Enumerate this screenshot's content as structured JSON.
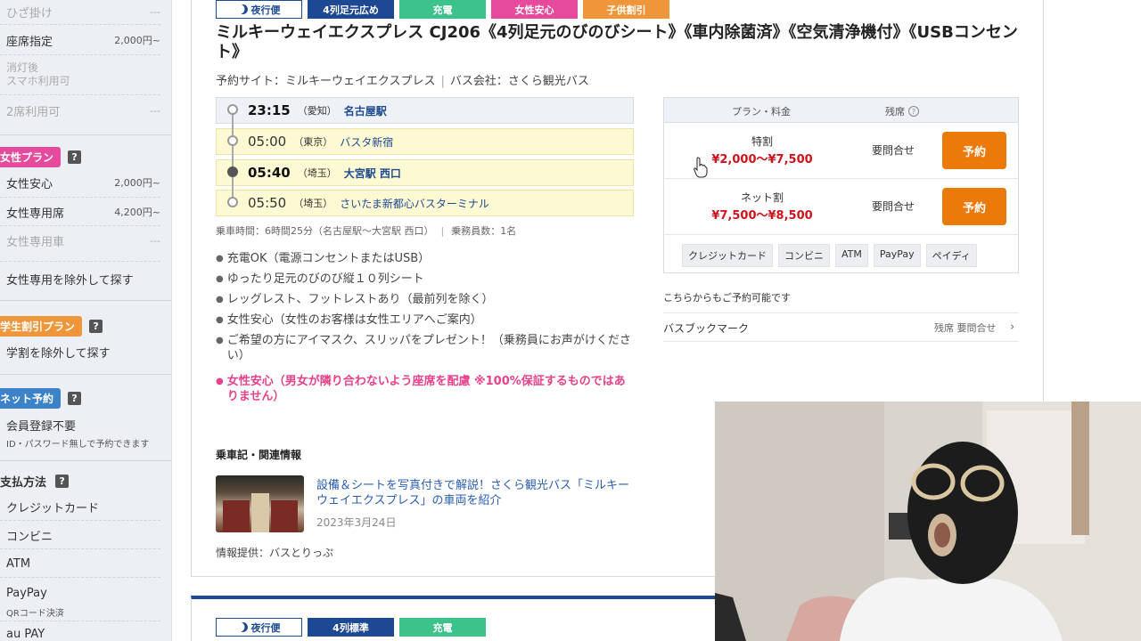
{
  "sidebar": {
    "items_top": [
      {
        "label": "ひざ掛け",
        "price": "---"
      },
      {
        "label": "座席指定",
        "price": "2,000円~"
      }
    ],
    "lights_off_line1": "消灯後",
    "lights_off_line2": "スマホ利用可",
    "two_seats": {
      "label": "2席利用可",
      "price": "---"
    },
    "women_plan": {
      "tag": "女性プラン",
      "help": "?"
    },
    "women_items": [
      {
        "label": "女性安心",
        "price": "2,000円~"
      },
      {
        "label": "女性専用席",
        "price": "4,200円~"
      },
      {
        "label": "女性専用車",
        "price": "---"
      }
    ],
    "exclude_women": "女性専用を除外して探す",
    "student_plan": {
      "tag": "学生割引プラン",
      "help": "?"
    },
    "exclude_student": "学割を除外して探す",
    "net_booking": {
      "tag": "ネット予約",
      "help": "?"
    },
    "no_membership": "会員登録不要",
    "no_membership_sub": "ID・パスワード無しで予約できます",
    "payment_head": "支払方法",
    "payment_help": "?",
    "payments": [
      "クレジットカード",
      "コンビニ",
      "ATM",
      "PayPay"
    ],
    "paypay_sub": "QRコード決済",
    "aupay": "au PAY"
  },
  "listing": {
    "badges": [
      "夜行便",
      "4列足元広め",
      "充電",
      "女性安心",
      "子供割引"
    ],
    "title": "ミルキーウェイエクスプレス CJ206《4列足元のびのびシート》《車内除菌済》《空気清浄機付》《USBコンセント》",
    "booking_site": "予約サイト：ミルキーウェイエクスプレス",
    "bus_company": "バス会社：さくら観光バス",
    "stops": [
      {
        "time": "23:15",
        "pref": "（愛知）",
        "place": "名古屋駅"
      },
      {
        "time": "05:00",
        "pref": "（東京）",
        "place": "バスタ新宿"
      },
      {
        "time": "05:40",
        "pref": "（埼玉）",
        "place": "大宮駅 西口"
      },
      {
        "time": "05:50",
        "pref": "（埼玉）",
        "place": "さいたま新都心バスターミナル"
      }
    ],
    "ride_time": "乗車時間：6時間25分（名古屋駅～大宮駅 西口）",
    "crew": "乗務員数：1名",
    "features": [
      "充電OK（電源コンセントまたはUSB）",
      "ゆったり足元のびのび縦１０列シート",
      "レッグレスト、フットレストあり（最前列を除く）",
      "女性安心（女性のお客様は女性エリアへご案内）",
      "ご希望の方にアイマスク、スリッパをプレゼント！（乗務員にお声がけください）"
    ],
    "women_note": "女性安心（男女が隣り合わないよう座席を配慮 ※100%保証するものではありません）",
    "related_head": "乗車記・関連情報",
    "related_link": "設備＆シートを写真付きで解説！さくら観光バス「ミルキーウェイエクスプレス」の車両を紹介",
    "related_date": "2023年3月24日",
    "provider": "情報提供：バスとりっぷ"
  },
  "price_table": {
    "col_plan": "プラン・料金",
    "col_seats": "残席",
    "rows": [
      {
        "name": "特割",
        "price": "¥2,000～¥7,500",
        "seats": "要問合せ",
        "button": "予約"
      },
      {
        "name": "ネット割",
        "price": "¥7,500～¥8,500",
        "seats": "要問合せ",
        "button": "予約"
      }
    ],
    "payments": [
      "クレジットカード",
      "コンビニ",
      "ATM",
      "PayPay",
      "ペイディ"
    ]
  },
  "also": {
    "text": "こちらからもご予約可能です",
    "site": "バスブックマーク",
    "seats": "残席 要問合せ"
  },
  "next_listing": {
    "badges": [
      "夜行便",
      "4列標準",
      "充電"
    ]
  },
  "colors": {
    "navy": "#1d4893",
    "green": "#3cc38c",
    "pink": "#e64a9c",
    "orange": "#f0963a",
    "reserve": "#ec7a0b",
    "price_red": "#d0121b"
  }
}
